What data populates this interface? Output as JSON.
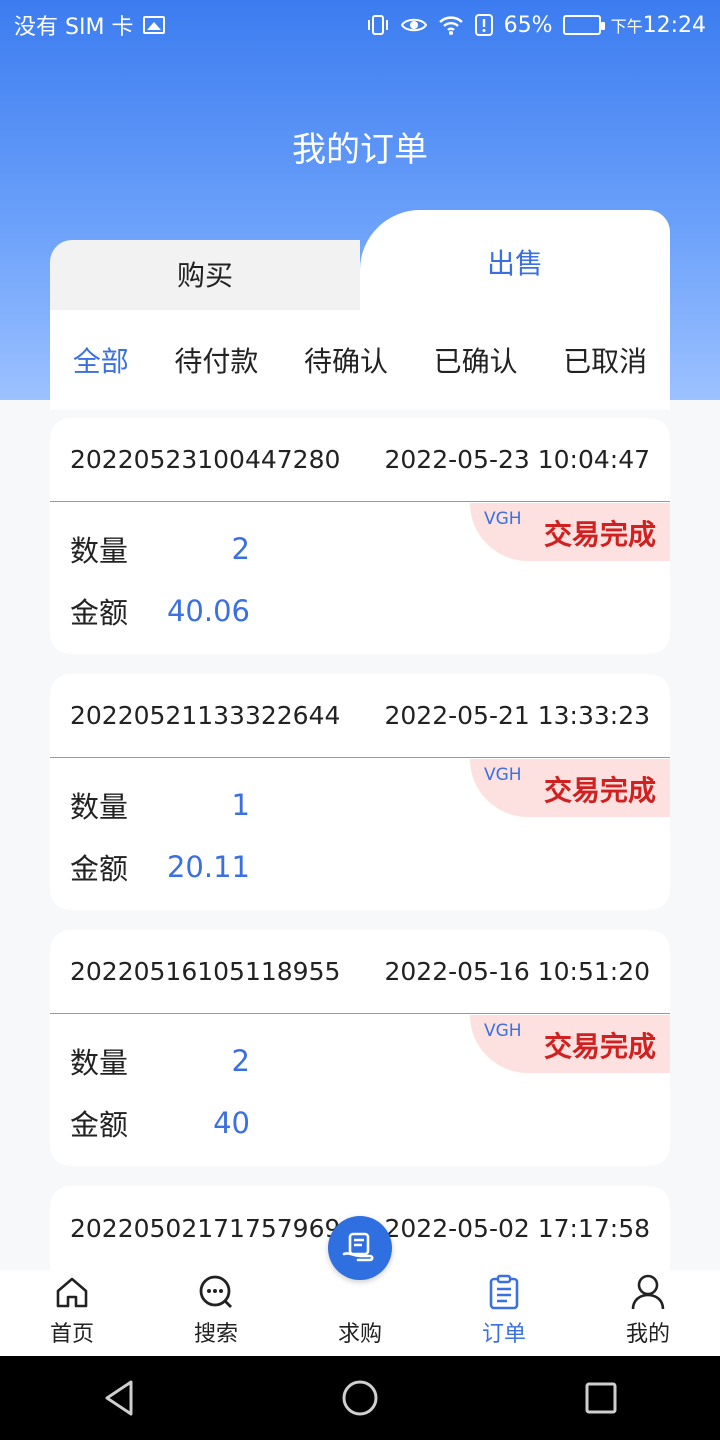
{
  "status_bar": {
    "carrier": "没有 SIM 卡",
    "battery": "65%",
    "battery_level": 0.65,
    "time_prefix": "下午",
    "time": "12:24"
  },
  "page": {
    "title": "我的订单"
  },
  "tabs": {
    "buy": "购买",
    "sell": "出售"
  },
  "filters": [
    "全部",
    "待付款",
    "待确认",
    "已确认",
    "已取消"
  ],
  "order_labels": {
    "quantity": "数量",
    "amount": "金额"
  },
  "orders": [
    {
      "id": "20220523100447280",
      "datetime": "2022-05-23 10:04:47",
      "quantity": "2",
      "amount": "40.06",
      "code": "VGH",
      "status": "交易完成"
    },
    {
      "id": "20220521133322644",
      "datetime": "2022-05-21 13:33:23",
      "quantity": "1",
      "amount": "20.11",
      "code": "VGH",
      "status": "交易完成"
    },
    {
      "id": "20220516105118955",
      "datetime": "2022-05-16 10:51:20",
      "quantity": "2",
      "amount": "40",
      "code": "VGH",
      "status": "交易完成"
    },
    {
      "id": "20220502171757969",
      "datetime": "2022-05-02 17:17:58"
    }
  ],
  "nav": [
    {
      "label": "首页",
      "icon": "home-icon"
    },
    {
      "label": "搜索",
      "icon": "chat-search-icon"
    },
    {
      "label": "求购",
      "icon": "request-buy-icon"
    },
    {
      "label": "订单",
      "icon": "clipboard-icon"
    },
    {
      "label": "我的",
      "icon": "person-icon"
    }
  ],
  "colors": {
    "accent": "#3a70e0",
    "status_red": "#d0201f",
    "tag_bg": "#fde0e0"
  }
}
